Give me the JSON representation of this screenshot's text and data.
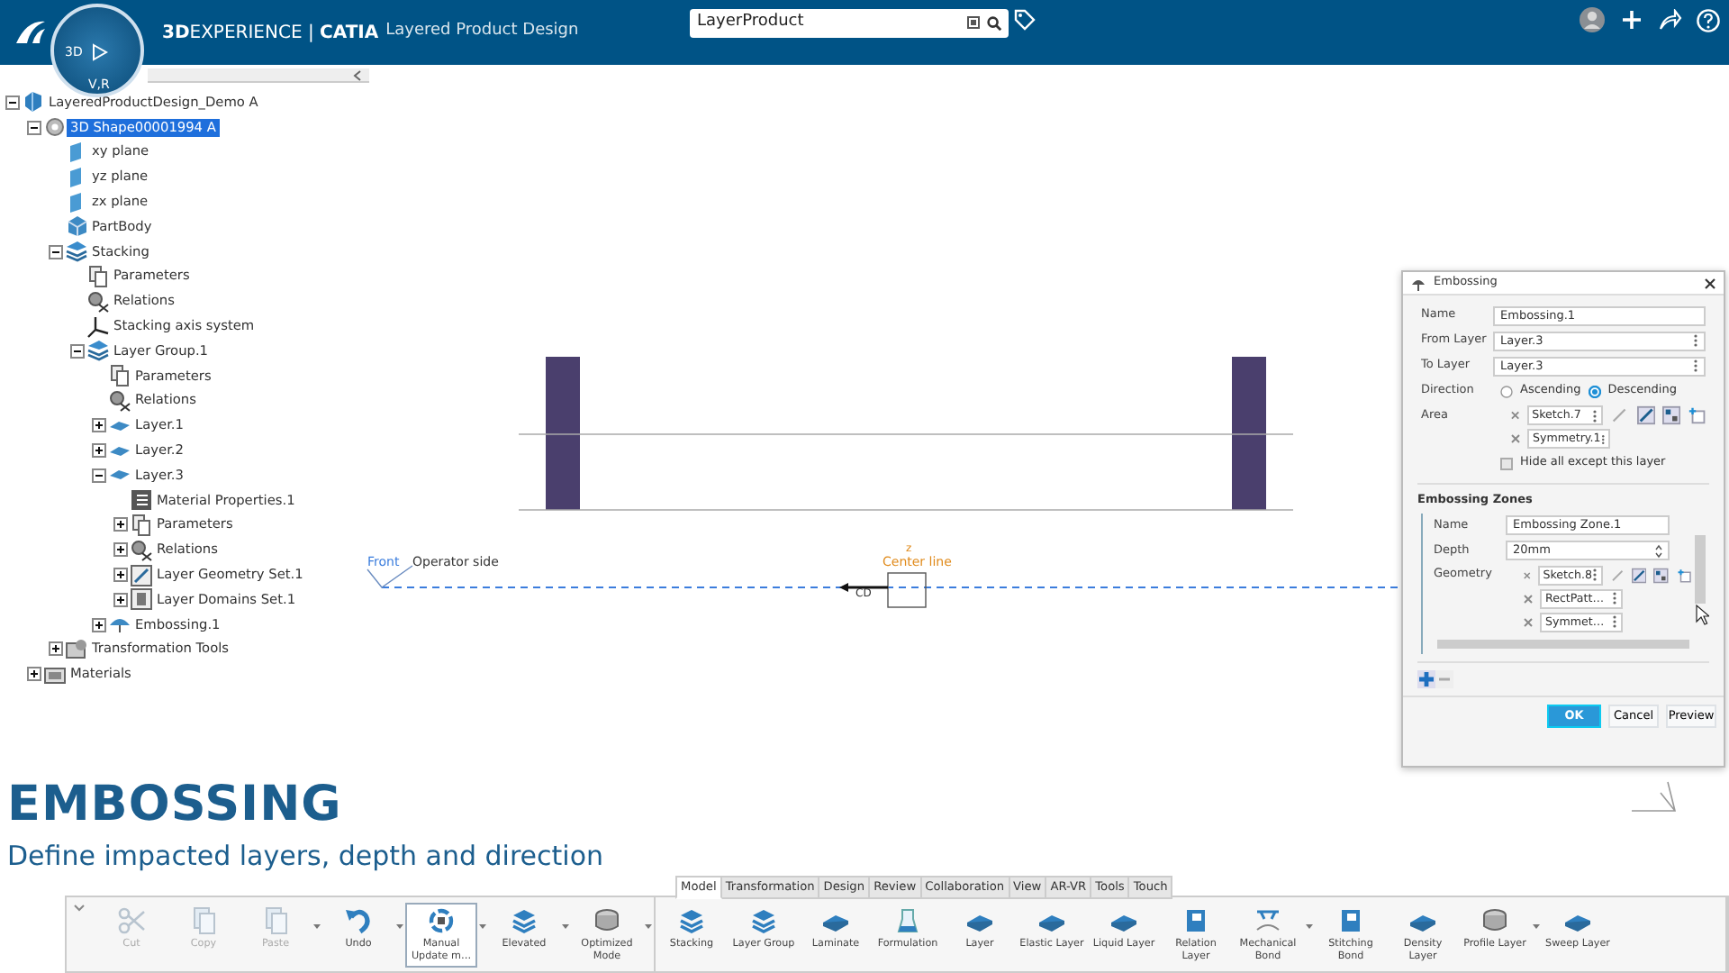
{
  "top_bar": {
    "compass": {
      "left": "3D",
      "bottom": "V,R"
    },
    "brand": "**3D**EXPERIENCE | **CATIA**",
    "app_name": "Layered Product Design",
    "search": {
      "value": "LayerProduct"
    }
  },
  "tree": [
    {
      "kind": "product",
      "label": "LayeredProductDesign_Demo A",
      "expanded": true,
      "selected": false,
      "children": [
        {
          "kind": "shape",
          "label": "3D Shape00001994 A",
          "expanded": true,
          "selected": true,
          "children": [
            {
              "kind": "plane",
              "label": "xy plane",
              "selected": false
            },
            {
              "kind": "plane",
              "label": "yz plane",
              "selected": false
            },
            {
              "kind": "plane",
              "label": "zx plane",
              "selected": false
            },
            {
              "kind": "body",
              "label": "PartBody",
              "selected": false
            },
            {
              "kind": "stack",
              "label": "Stacking",
              "expanded": true,
              "selected": false,
              "children": [
                {
                  "kind": "params",
                  "label": "Parameters",
                  "selected": false
                },
                {
                  "kind": "relations",
                  "label": "Relations",
                  "selected": false
                },
                {
                  "kind": "axis",
                  "label": "Stacking axis system",
                  "selected": false
                },
                {
                  "kind": "stack",
                  "label": "Layer Group.1",
                  "expanded": true,
                  "selected": false,
                  "children": [
                    {
                      "kind": "params",
                      "label": "Parameters",
                      "selected": false
                    },
                    {
                      "kind": "relations",
                      "label": "Relations",
                      "selected": false
                    },
                    {
                      "kind": "layer",
                      "label": "Layer.1",
                      "expanded": false,
                      "selected": false
                    },
                    {
                      "kind": "layer",
                      "label": "Layer.2",
                      "expanded": false,
                      "selected": false
                    },
                    {
                      "kind": "layer",
                      "label": "Layer.3",
                      "expanded": true,
                      "selected": false,
                      "children": [
                        {
                          "kind": "table",
                          "label": "Material Properties.1",
                          "selected": false
                        },
                        {
                          "kind": "params",
                          "label": "Parameters",
                          "expanded": false,
                          "selected": false
                        },
                        {
                          "kind": "relations",
                          "label": "Relations",
                          "expanded": false,
                          "selected": false
                        },
                        {
                          "kind": "geomset",
                          "label": "Layer Geometry Set.1",
                          "expanded": false,
                          "selected": false
                        },
                        {
                          "kind": "domains",
                          "label": "Layer Domains Set.1",
                          "expanded": false,
                          "selected": false
                        }
                      ]
                    },
                    {
                      "kind": "embossing",
                      "label": "Embossing.1",
                      "expanded": false,
                      "selected": false
                    }
                  ]
                }
              ]
            },
            {
              "kind": "tools",
              "label": "Transformation Tools",
              "expanded": false,
              "selected": false
            }
          ]
        },
        {
          "kind": "folder",
          "label": "Materials",
          "expanded": false,
          "selected": false
        }
      ]
    }
  ],
  "viewport": {
    "front_label": "Front",
    "operator_label": "Operator side",
    "center_label": "Center line",
    "z_label": "z",
    "cd_label": "CD"
  },
  "dialog": {
    "title": "Embossing",
    "fields": [
      {
        "label": "Name",
        "value": "Embossing.1",
        "kind": "text"
      },
      {
        "label": "From Layer",
        "value": "Layer.3",
        "kind": "select"
      },
      {
        "label": "To Layer",
        "value": "Layer.3",
        "kind": "select"
      }
    ],
    "direction": {
      "label": "Direction",
      "options": [
        {
          "label": "Ascending",
          "selected": false
        },
        {
          "label": "Descending",
          "selected": true
        }
      ]
    },
    "area": {
      "label": "Area",
      "items": [
        "Sketch.7",
        "Symmetry.1"
      ]
    },
    "hide_others": {
      "label": "Hide all except this layer",
      "checked": false
    },
    "zones": {
      "title": "Embossing Zones",
      "name_label": "Name",
      "name": "Embossing Zone.1",
      "depth_label": "Depth",
      "depth": "20mm",
      "geometry_label": "Geometry",
      "geometry": [
        "Sketch.8",
        "RectPatt…",
        "Symmet…"
      ]
    },
    "buttons": [
      {
        "label": "OK",
        "primary": true
      },
      {
        "label": "Cancel",
        "primary": false
      },
      {
        "label": "Preview",
        "primary": false
      }
    ]
  },
  "heading": {
    "title": "EMBOSSING",
    "subtitle": "Define impacted layers, depth and direction"
  },
  "ribbon": {
    "tabs": [
      {
        "label": "Model",
        "selected": true
      },
      {
        "label": "Transformation",
        "selected": false
      },
      {
        "label": "Design",
        "selected": false
      },
      {
        "label": "Review",
        "selected": false
      },
      {
        "label": "Collaboration",
        "selected": false
      },
      {
        "label": "View",
        "selected": false
      },
      {
        "label": "AR-VR",
        "selected": false
      },
      {
        "label": "Tools",
        "selected": false
      },
      {
        "label": "Touch",
        "selected": false
      }
    ],
    "groups": [
      {
        "buttons": [
          {
            "label": "Cut",
            "kind": "scissors",
            "disabled": true,
            "dropdown": false,
            "active": false
          },
          {
            "label": "Copy",
            "kind": "copy",
            "disabled": true,
            "dropdown": false,
            "active": false
          },
          {
            "label": "Paste",
            "kind": "copy",
            "disabled": true,
            "dropdown": true,
            "active": false
          },
          {
            "label": "Undo",
            "kind": "undo",
            "disabled": false,
            "dropdown": true,
            "active": false
          },
          {
            "label": "Manual Update m…",
            "kind": "update",
            "disabled": false,
            "dropdown": true,
            "active": true
          },
          {
            "label": "Elevated",
            "kind": "stack",
            "disabled": false,
            "dropdown": true,
            "active": false
          },
          {
            "label": "Optimized Mode",
            "kind": "disk",
            "disabled": false,
            "dropdown": true,
            "active": false
          }
        ]
      },
      {
        "buttons": [
          {
            "label": "Stacking",
            "kind": "stack",
            "disabled": false,
            "dropdown": false,
            "active": false
          },
          {
            "label": "Layer Group",
            "kind": "stack",
            "disabled": false,
            "dropdown": false,
            "active": false
          },
          {
            "label": "Laminate",
            "kind": "slab",
            "disabled": false,
            "dropdown": false,
            "active": false
          },
          {
            "label": "Formulation",
            "kind": "beaker",
            "disabled": false,
            "dropdown": false,
            "active": false
          },
          {
            "label": "Layer",
            "kind": "slab",
            "disabled": false,
            "dropdown": false,
            "active": false
          },
          {
            "label": "Elastic Layer",
            "kind": "slab",
            "disabled": false,
            "dropdown": false,
            "active": false
          },
          {
            "label": "Liquid Layer",
            "kind": "slab",
            "disabled": false,
            "dropdown": false,
            "active": false
          },
          {
            "label": "Relation Layer",
            "kind": "page",
            "disabled": false,
            "dropdown": false,
            "active": false
          },
          {
            "label": "Mechanical Bond",
            "kind": "bond",
            "disabled": false,
            "dropdown": true,
            "active": false
          },
          {
            "label": "Stitching Bond",
            "kind": "page",
            "disabled": false,
            "dropdown": false,
            "active": false
          },
          {
            "label": "Density Layer",
            "kind": "slab",
            "disabled": false,
            "dropdown": false,
            "active": false
          },
          {
            "label": "Profile Layer",
            "kind": "disk",
            "disabled": false,
            "dropdown": true,
            "active": false
          },
          {
            "label": "Sweep Layer",
            "kind": "slab",
            "disabled": false,
            "dropdown": false,
            "active": false
          }
        ]
      }
    ]
  }
}
